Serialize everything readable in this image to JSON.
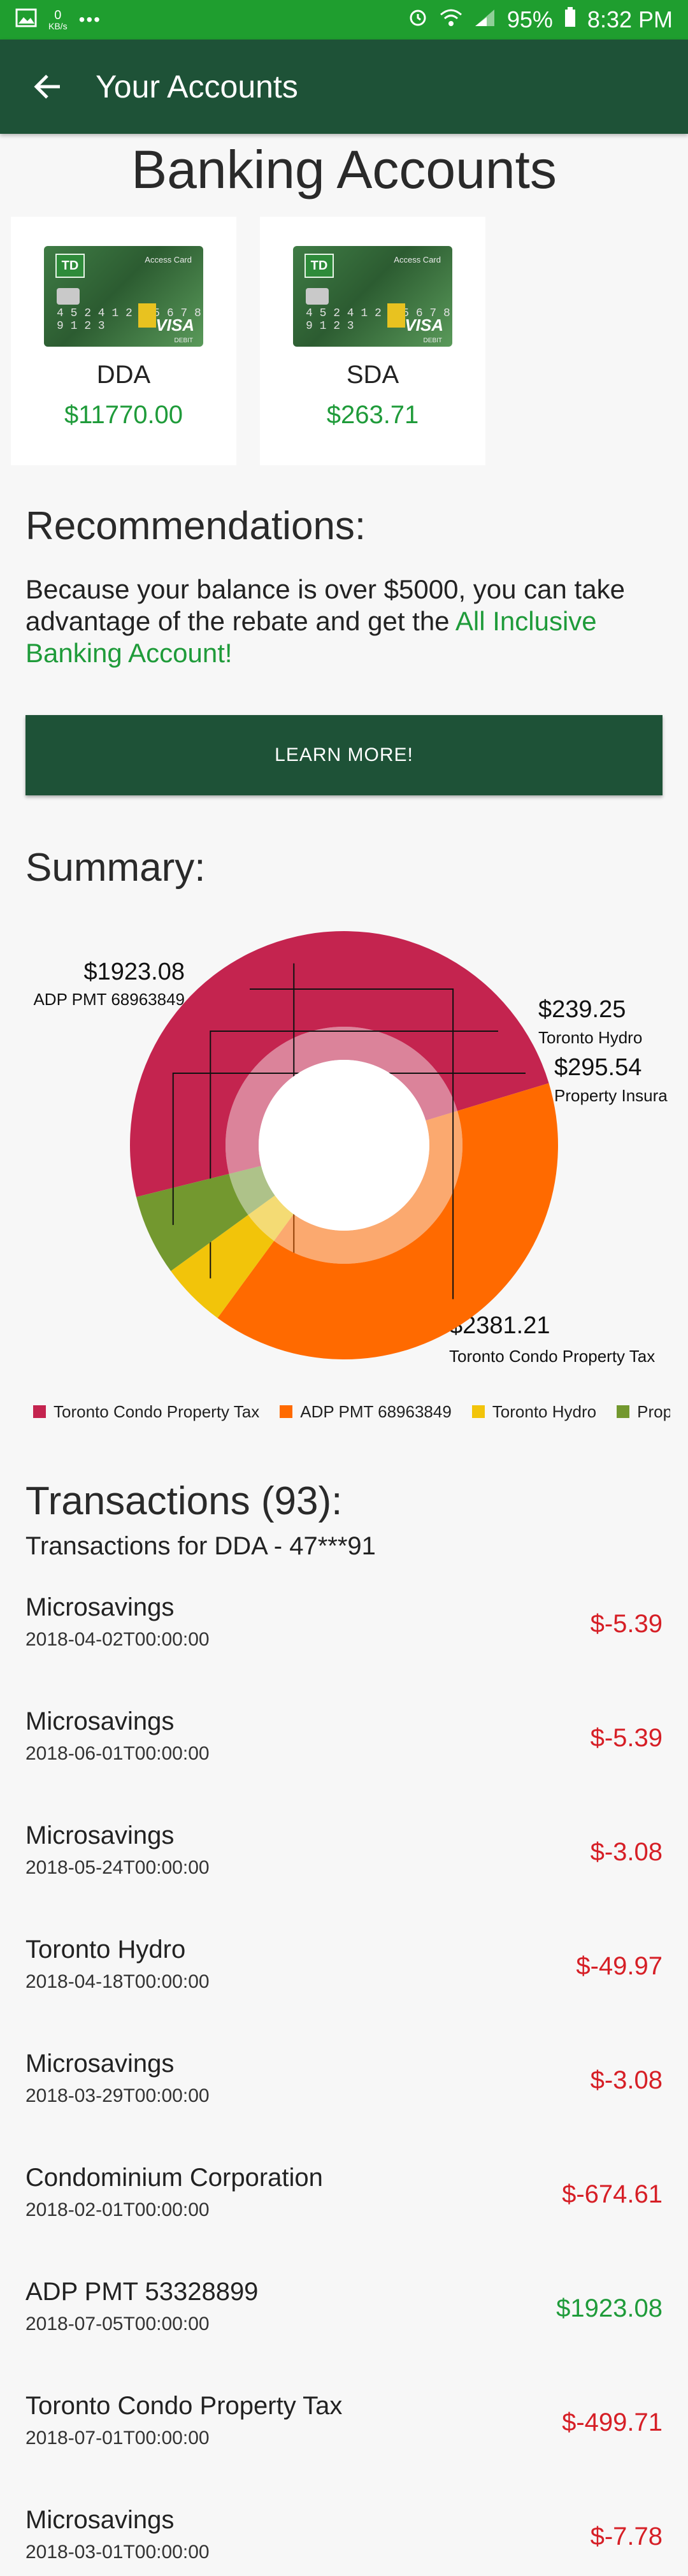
{
  "status_bar": {
    "speed": "0",
    "speed_unit": "KB/s",
    "dots": "•••",
    "battery": "95%",
    "time": "8:32 PM"
  },
  "app_bar": {
    "title": "Your Accounts"
  },
  "page_title": "Banking Accounts",
  "accounts": [
    {
      "name": "DDA",
      "balance": "$11770.00",
      "card_label": "Access Card",
      "card_number": "4 5 2 4   1 2 3  5 6 7 8   9 1 2 3",
      "card_brand": "VISA",
      "card_type": "DEBIT",
      "bank_logo": "TD"
    },
    {
      "name": "SDA",
      "balance": "$263.71",
      "card_label": "Access Card",
      "card_number": "4 5 2 4   1 2 3  5 6 7 8   9 1 2 3",
      "card_brand": "VISA",
      "card_type": "DEBIT",
      "bank_logo": "TD"
    }
  ],
  "recommendations": {
    "heading": "Recommendations:",
    "text": "Because your balance is over $5000, you can take advantage of the rebate and get the ",
    "link": "All Inclusive Banking Account!",
    "button": "LEARN MORE!"
  },
  "summary": {
    "heading": "Summary:"
  },
  "chart_data": {
    "type": "pie",
    "style": "donut",
    "series": [
      {
        "name": "Toronto Condo Property Tax",
        "value": 2381.21,
        "label": "$2381.21",
        "color": "#c4244f"
      },
      {
        "name": "ADP PMT 68963849",
        "value": 1923.08,
        "label": "$1923.08",
        "color": "#ff6a00"
      },
      {
        "name": "Toronto Hydro",
        "value": 239.25,
        "label": "$239.25",
        "color": "#f2c40a"
      },
      {
        "name": "Property Insurance",
        "value": 295.54,
        "label": "$295.54",
        "color": "#73982f"
      }
    ],
    "callout_names": [
      "Toronto Condo Property Tax",
      "ADP PMT 68963849",
      "Toronto Hydro",
      "Property Insura"
    ],
    "legend_labels": [
      "Toronto Condo Property Tax",
      "ADP PMT 68963849",
      "Toronto Hydro",
      "Prope"
    ],
    "legend_position": "bottom"
  },
  "transactions": {
    "title": "Transactions (93):",
    "subtitle": "Transactions for DDA - 47***91",
    "items": [
      {
        "name": "Microsavings",
        "date": "2018-04-02T00:00:00",
        "amount": "$-5.39",
        "sign": "neg"
      },
      {
        "name": "Microsavings",
        "date": "2018-06-01T00:00:00",
        "amount": "$-5.39",
        "sign": "neg"
      },
      {
        "name": "Microsavings",
        "date": "2018-05-24T00:00:00",
        "amount": "$-3.08",
        "sign": "neg"
      },
      {
        "name": "Toronto Hydro",
        "date": "2018-04-18T00:00:00",
        "amount": "$-49.97",
        "sign": "neg"
      },
      {
        "name": "Microsavings",
        "date": "2018-03-29T00:00:00",
        "amount": "$-3.08",
        "sign": "neg"
      },
      {
        "name": "Condominium Corporation",
        "date": "2018-02-01T00:00:00",
        "amount": "$-674.61",
        "sign": "neg"
      },
      {
        "name": "ADP PMT 53328899",
        "date": "2018-07-05T00:00:00",
        "amount": "$1923.08",
        "sign": "pos"
      },
      {
        "name": "Toronto Condo Property Tax",
        "date": "2018-07-01T00:00:00",
        "amount": "$-499.71",
        "sign": "neg"
      },
      {
        "name": "Microsavings",
        "date": "2018-03-01T00:00:00",
        "amount": "$-7.78",
        "sign": "neg"
      }
    ]
  }
}
